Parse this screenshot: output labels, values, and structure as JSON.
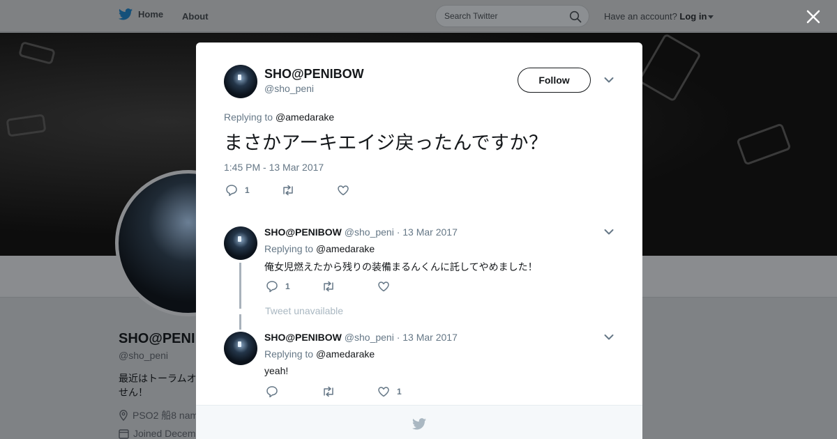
{
  "nav": {
    "home_label": "Home",
    "about_label": "About",
    "search_placeholder": "Search Twitter",
    "account_prompt": "Have an account?",
    "login_label": "Log in"
  },
  "profile": {
    "name": "SHO@PENIBOW",
    "name_visible": "SHO@PENI",
    "handle": "@sho_peni",
    "bio": "最近はトーラムオ せん！",
    "bio_line1": "最近はトーラムオ",
    "bio_line2": "せん！",
    "location": "PSO2 船8 nam",
    "joined": "Joined Decem"
  },
  "tweet": {
    "author_name": "SHO@PENIBOW",
    "author_handle": "@sho_peni",
    "follow_label": "Follow",
    "replying_prefix": "Replying to",
    "replying_to": "@amedarake",
    "text": "まさかアーキエイジ戻ったんですか？",
    "timestamp": "1:45 PM - 13 Mar 2017",
    "reply_count": "1",
    "retweet_count": "",
    "like_count": ""
  },
  "replies": [
    {
      "name": "SHO@PENIBOW",
      "handle": "@sho_peni",
      "date": "· 13 Mar 2017",
      "replying_prefix": "Replying to",
      "replying_to": "@amedarake",
      "text": "俺女児燃えたから残りの装備まるんくんに託してやめました！",
      "reply_count": "1",
      "retweet_count": "",
      "like_count": ""
    },
    {
      "name": "SHO@PENIBOW",
      "handle": "@sho_peni",
      "date": "· 13 Mar 2017",
      "replying_prefix": "Replying to",
      "replying_to": "@amedarake",
      "text": "yeah!",
      "reply_count": "",
      "retweet_count": "",
      "like_count": "1"
    }
  ],
  "unavailable_text": "Tweet unavailable",
  "colors": {
    "twitter_blue": "#1da1f2",
    "secondary_text": "#657786",
    "overlay": "#7f8285"
  }
}
